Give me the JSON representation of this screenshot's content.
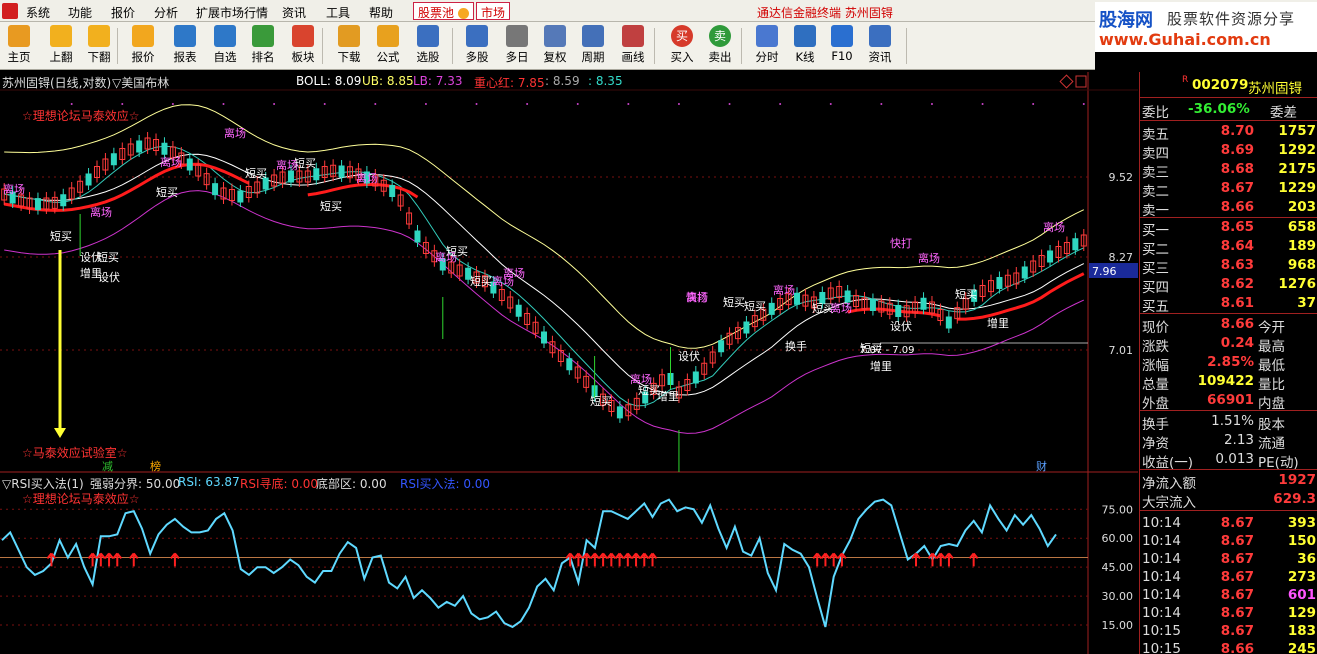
{
  "menu": {
    "items": [
      "系统",
      "功能",
      "报价",
      "分析",
      "扩展市场行情",
      "资讯",
      "工具",
      "帮助"
    ],
    "stock_pool": "股票池",
    "market": "市场",
    "window_title": "通达信金融终端  苏州固锝"
  },
  "brand": {
    "name": "股海网",
    "slogan": "股票软件资源分享",
    "url": "www.Guhai.com.cn"
  },
  "toolbar": {
    "buttons": [
      {
        "label": "主页",
        "icon": "home-icon"
      },
      {
        "label": "上翻",
        "icon": "arrow-up-icon"
      },
      {
        "label": "下翻",
        "icon": "arrow-down-icon"
      },
      {
        "label": "报价",
        "icon": "yen-icon"
      },
      {
        "label": "报表",
        "icon": "report-icon"
      },
      {
        "label": "自选",
        "icon": "f6-icon"
      },
      {
        "label": "排名",
        "icon": "ranking-icon"
      },
      {
        "label": "板块",
        "icon": "blocks-icon"
      },
      {
        "label": "下载",
        "icon": "download-icon"
      },
      {
        "label": "公式",
        "icon": "formula-icon"
      },
      {
        "label": "选股",
        "icon": "stock-select-icon"
      },
      {
        "label": "多股",
        "icon": "multi-stock-icon"
      },
      {
        "label": "多日",
        "icon": "multi-day-icon"
      },
      {
        "label": "复权",
        "icon": "restore-icon"
      },
      {
        "label": "周期",
        "icon": "f8-icon"
      },
      {
        "label": "画线",
        "icon": "draw-line-icon"
      },
      {
        "label": "买入",
        "icon": "buy-icon",
        "glyph": "买"
      },
      {
        "label": "卖出",
        "icon": "sell-icon",
        "glyph": "卖"
      },
      {
        "label": "分时",
        "icon": "intraday-icon"
      },
      {
        "label": "K线",
        "icon": "kline-icon"
      },
      {
        "label": "F10",
        "icon": "f10-icon"
      },
      {
        "label": "资讯",
        "icon": "news-icon"
      }
    ]
  },
  "chart": {
    "title": "苏州固锝(日线,对数)",
    "indicator": "▽美国布林",
    "boll_label": "BOLL: 8.09",
    "ub_label": "UB: 8.85",
    "lb_label": "LB: 7.33",
    "center_label": "重心红: 7.85",
    "v2": ": 8.59",
    "v3": ": 8.35",
    "forum_label": "☆理想论坛马泰效应☆",
    "lab_label": "☆马泰效应试验室☆",
    "price_ticks": [
      "9.52",
      "8.27",
      "7.01"
    ],
    "current_price_tag": "7.96",
    "range_label": "7.07 - 7.09",
    "bottom_markers": [
      {
        "text": "减",
        "color": "#2fbf2f"
      },
      {
        "text": "榜",
        "color": "#ffaa00"
      },
      {
        "text": "财",
        "color": "#5aa0ff"
      }
    ],
    "annotations": [
      {
        "text": "离场",
        "color": "#ff66ff"
      },
      {
        "text": "短买",
        "color": "#ffffff"
      },
      {
        "text": "离场",
        "color": "#ff66ff"
      },
      {
        "text": "设伏",
        "color": "#ffffff"
      },
      {
        "text": "短买",
        "color": "#ffffff"
      },
      {
        "text": "增里",
        "color": "#ffffff"
      },
      {
        "text": "设伏",
        "color": "#ffffff"
      },
      {
        "text": "短买",
        "color": "#ffffff"
      },
      {
        "text": "离场",
        "color": "#ff66ff"
      },
      {
        "text": "离场",
        "color": "#ff66ff"
      },
      {
        "text": "短买",
        "color": "#ffffff"
      },
      {
        "text": "离场",
        "color": "#ff66ff"
      },
      {
        "text": "短买",
        "color": "#ffffff"
      },
      {
        "text": "短买",
        "color": "#ffffff"
      },
      {
        "text": "离场",
        "color": "#ff66ff"
      },
      {
        "text": "短买",
        "color": "#ffffff"
      },
      {
        "text": "离场",
        "color": "#ff66ff"
      },
      {
        "text": "离场",
        "color": "#ff66ff"
      },
      {
        "text": "短买",
        "color": "#ffffff"
      },
      {
        "text": "离场",
        "color": "#ff66ff"
      },
      {
        "text": "短买",
        "color": "#ffffff"
      },
      {
        "text": "离场",
        "color": "#ff66ff"
      },
      {
        "text": "短买",
        "color": "#ffffff"
      },
      {
        "text": "短买",
        "color": "#ffffff"
      },
      {
        "text": "增里",
        "color": "#ffffff"
      },
      {
        "text": "设伏",
        "color": "#ffffff"
      },
      {
        "text": "快打",
        "color": "#ff66ff"
      },
      {
        "text": "离场",
        "color": "#ff66ff"
      },
      {
        "text": "短买",
        "color": "#ffffff"
      },
      {
        "text": "离场",
        "color": "#ff66ff"
      },
      {
        "text": "短买",
        "color": "#ffffff"
      },
      {
        "text": "离场",
        "color": "#ff66ff"
      },
      {
        "text": "换手",
        "color": "#ffffff"
      },
      {
        "text": "短买",
        "color": "#ffffff"
      },
      {
        "text": "增里",
        "color": "#ffffff"
      },
      {
        "text": "快打",
        "color": "#ff66ff"
      },
      {
        "text": "离场",
        "color": "#ff66ff"
      },
      {
        "text": "设伏",
        "color": "#ffffff"
      },
      {
        "text": "短买",
        "color": "#ffffff"
      },
      {
        "text": "增里",
        "color": "#ffffff"
      },
      {
        "text": "离场",
        "color": "#ff66ff"
      }
    ]
  },
  "rsi": {
    "title": "▽RSI买入法(1)",
    "strength": "强弱分界: 50.00",
    "rsi_val": "RSI: 63.87",
    "rsi_bottom": "RSI寻底: 0.00",
    "bottom_zone": "底部区: 0.00",
    "rsi_buy": "RSI买入法: 0.00",
    "forum_label": "☆理想论坛马泰效应☆",
    "ticks": [
      "75.00",
      "60.00",
      "45.00",
      "30.00",
      "15.00"
    ],
    "values": [
      59,
      63,
      54,
      45,
      41,
      43,
      47,
      59,
      50,
      57,
      45,
      36,
      61,
      61,
      62,
      73,
      74,
      65,
      52,
      62,
      67,
      70,
      66,
      63,
      63,
      64,
      70,
      73,
      64,
      44,
      41,
      45,
      45,
      42,
      45,
      49,
      46,
      40,
      37,
      43,
      43,
      52,
      58,
      55,
      39,
      50,
      51,
      37,
      34,
      40,
      29,
      33,
      29,
      24,
      27,
      25,
      30,
      21,
      18,
      19,
      22,
      16,
      14,
      17,
      24,
      35,
      39,
      33,
      47,
      50,
      37,
      59,
      55,
      74,
      74,
      72,
      70,
      74,
      78,
      71,
      78,
      80,
      74,
      76,
      75,
      68,
      77,
      65,
      55,
      66,
      53,
      51,
      60,
      42,
      33,
      57,
      54,
      52,
      45,
      29,
      14,
      40,
      51,
      59,
      70,
      75,
      79,
      80,
      77,
      63,
      49,
      52,
      56,
      49,
      56,
      57,
      56,
      64,
      69,
      63,
      77,
      70,
      64,
      72,
      67,
      72,
      65,
      56,
      62
    ],
    "arrows_at": [
      6,
      11,
      12,
      13,
      14,
      16,
      21,
      69,
      70,
      71,
      72,
      73,
      74,
      75,
      76,
      77,
      78,
      79,
      99,
      100,
      101,
      102,
      111,
      113,
      114,
      115,
      118
    ]
  },
  "quote": {
    "code": "002079",
    "name": "苏州固锝",
    "webi_label": "委比",
    "webi_val": "-36.06%",
    "weicha_label": "委差",
    "asks": [
      {
        "label": "卖五",
        "price": "8.70",
        "vol": "1757"
      },
      {
        "label": "卖四",
        "price": "8.69",
        "vol": "1292"
      },
      {
        "label": "卖三",
        "price": "8.68",
        "vol": "2175"
      },
      {
        "label": "卖二",
        "price": "8.67",
        "vol": "1229"
      },
      {
        "label": "卖一",
        "price": "8.66",
        "vol": "203"
      }
    ],
    "bids": [
      {
        "label": "买一",
        "price": "8.65",
        "vol": "658"
      },
      {
        "label": "买二",
        "price": "8.64",
        "vol": "189"
      },
      {
        "label": "买三",
        "price": "8.63",
        "vol": "968"
      },
      {
        "label": "买四",
        "price": "8.62",
        "vol": "1276"
      },
      {
        "label": "买五",
        "price": "8.61",
        "vol": "37"
      }
    ],
    "stats": [
      {
        "label": "现价",
        "val": "8.66",
        "color": "#ff3b3b",
        "label2": "今开"
      },
      {
        "label": "涨跌",
        "val": "0.24",
        "color": "#ff3b3b",
        "label2": "最高"
      },
      {
        "label": "涨幅",
        "val": "2.85%",
        "color": "#ff3b3b",
        "label2": "最低"
      },
      {
        "label": "总量",
        "val": "109422",
        "color": "#ffff33",
        "label2": "量比"
      },
      {
        "label": "外盘",
        "val": "66901",
        "color": "#ff3b3b",
        "label2": "内盘"
      }
    ],
    "stats2": [
      {
        "label": "换手",
        "val": "1.51%",
        "label2": "股本"
      },
      {
        "label": "净资",
        "val": "2.13",
        "label2": "流通"
      },
      {
        "label": "收益(一)",
        "val": "0.013",
        "label2": "PE(动)"
      }
    ],
    "flows": [
      {
        "label": "净流入额",
        "val": "1927"
      },
      {
        "label": "大宗流入",
        "val": "629.3"
      }
    ],
    "ticks": [
      {
        "time": "10:14",
        "price": "8.67",
        "vol": "393",
        "vol_color": "#ffff33"
      },
      {
        "time": "10:14",
        "price": "8.67",
        "vol": "150",
        "vol_color": "#ffff33"
      },
      {
        "time": "10:14",
        "price": "8.67",
        "vol": "36",
        "vol_color": "#ffff33"
      },
      {
        "time": "10:14",
        "price": "8.67",
        "vol": "273",
        "vol_color": "#ffff33"
      },
      {
        "time": "10:14",
        "price": "8.67",
        "vol": "601",
        "vol_color": "#ff55ff"
      },
      {
        "time": "10:14",
        "price": "8.67",
        "vol": "129",
        "vol_color": "#ffff33"
      },
      {
        "time": "10:15",
        "price": "8.67",
        "vol": "183",
        "vol_color": "#ffff33"
      },
      {
        "time": "10:15",
        "price": "8.66",
        "vol": "245",
        "vol_color": "#ffff33"
      }
    ]
  },
  "colors": {
    "up": "#ff3b3b",
    "down": "#2fd7c0",
    "boll": "#ffff99",
    "lower": "#cc33cc",
    "mid": "#ffffff",
    "rsi": "#5fd9ff",
    "heavy": "#ff1c1c"
  }
}
